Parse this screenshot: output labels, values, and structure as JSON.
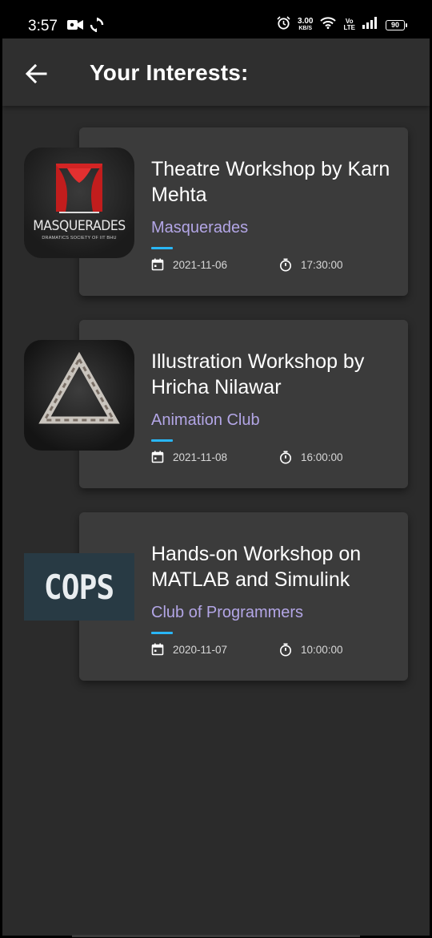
{
  "status_bar": {
    "time": "3:57",
    "speed_value": "3.00",
    "speed_unit": "KB/S",
    "volte_top": "Vo",
    "volte_bottom": "LTE",
    "battery": "90"
  },
  "header": {
    "title": "Your Interests:"
  },
  "events": [
    {
      "title": "Theatre Workshop by Karn Mehta",
      "club": "Masquerades",
      "date": "2021-11-06",
      "time": "17:30:00",
      "logo_text": "MASQUERADES",
      "logo_subtext": "DRAMATICS SOCIETY OF IIT BHU"
    },
    {
      "title": "Illustration Workshop by Hricha Nilawar",
      "club": "Animation Club",
      "date": "2021-11-08",
      "time": "16:00:00"
    },
    {
      "title": "Hands-on Workshop on MATLAB and Simulink",
      "club": "Club of Programmers",
      "date": "2020-11-07",
      "time": "10:00:00",
      "logo_text": "COPS"
    }
  ],
  "colors": {
    "background": "#2b2b2b",
    "card": "#3b3b3b",
    "club_text": "#b3a6e6",
    "accent_divider": "#29b6f6"
  },
  "icons": {
    "back": "arrow-left-icon",
    "date": "calendar-icon",
    "time": "timer-icon"
  }
}
